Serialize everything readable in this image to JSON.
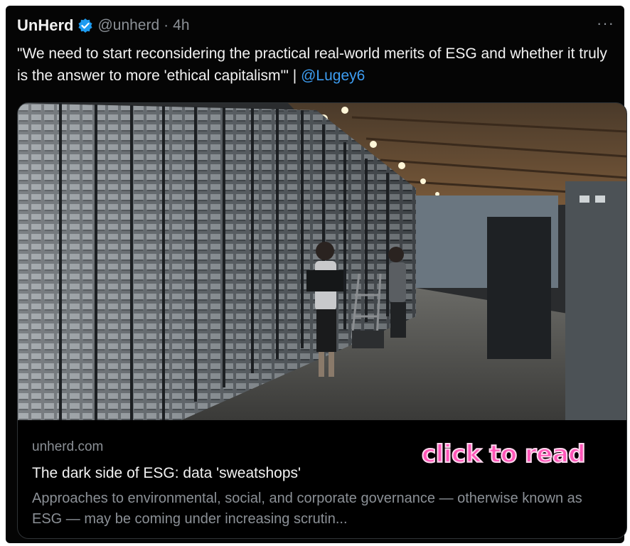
{
  "tweet": {
    "display_name": "UnHerd",
    "handle": "@unherd",
    "separator": "·",
    "time": "4h",
    "more_icon": "more-dots-icon",
    "verified_icon": "verified-badge-icon",
    "text": "\"We need to start reconsidering the practical real-world merits of ESG and whether it truly is the answer to more 'ethical capitalism'\" | ",
    "mention": "@Lugey6"
  },
  "card": {
    "image": "data-center-photo",
    "domain": "unherd.com",
    "title": "The dark side of ESG: data 'sweatshops'",
    "description": "Approaches to environmental, social, and corporate governance — otherwise known as ESG — may be coming under increasing scrutin..."
  },
  "overlay": {
    "label": "click to read"
  },
  "colors": {
    "background": "#050505",
    "text": "#f2f2f2",
    "muted": "#8b9096",
    "link": "#3d9df2",
    "verified": "#1d9bf0",
    "overlay_label": "#ff55b8"
  }
}
